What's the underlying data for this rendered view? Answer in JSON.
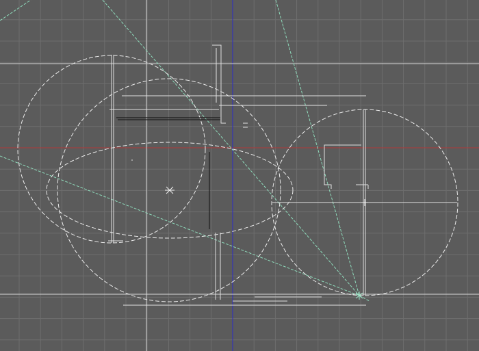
{
  "viewport": {
    "view": "top",
    "grid": true,
    "colors": {
      "background": "#5b5b5b",
      "grid_line": "#6e6e6e",
      "axis_x": "#b03a3a",
      "axis_y": "#2b2bc8",
      "wireframe": "#e8e8e8",
      "construction": "#9ee6c8",
      "dark_edge": "#1e1e1e"
    },
    "icons": {
      "pivot": "x-cross-icon",
      "camera_target": "star-icon"
    }
  }
}
